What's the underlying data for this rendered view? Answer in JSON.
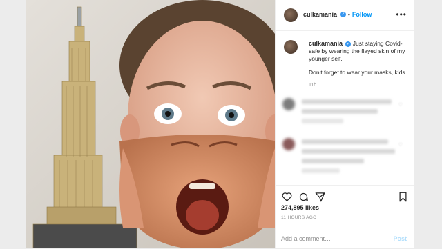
{
  "post": {
    "username": "culkamania",
    "follow_label": "Follow",
    "separator": "•",
    "more_icon": "more-horizontal-icon",
    "caption_line1": "Just staying Covid-safe by wearing the flayed skin of my younger self.",
    "caption_line2": "Don't forget to wear your masks, kids.",
    "caption_time": "11h",
    "likes": "274,895 likes",
    "date": "11 HOURS AGO",
    "add_comment_placeholder": "Add a comment…",
    "post_label": "Post"
  },
  "colors": {
    "link_blue": "#0095f6",
    "verified_blue": "#3897f0",
    "post_disabled": "#b2dffc"
  }
}
